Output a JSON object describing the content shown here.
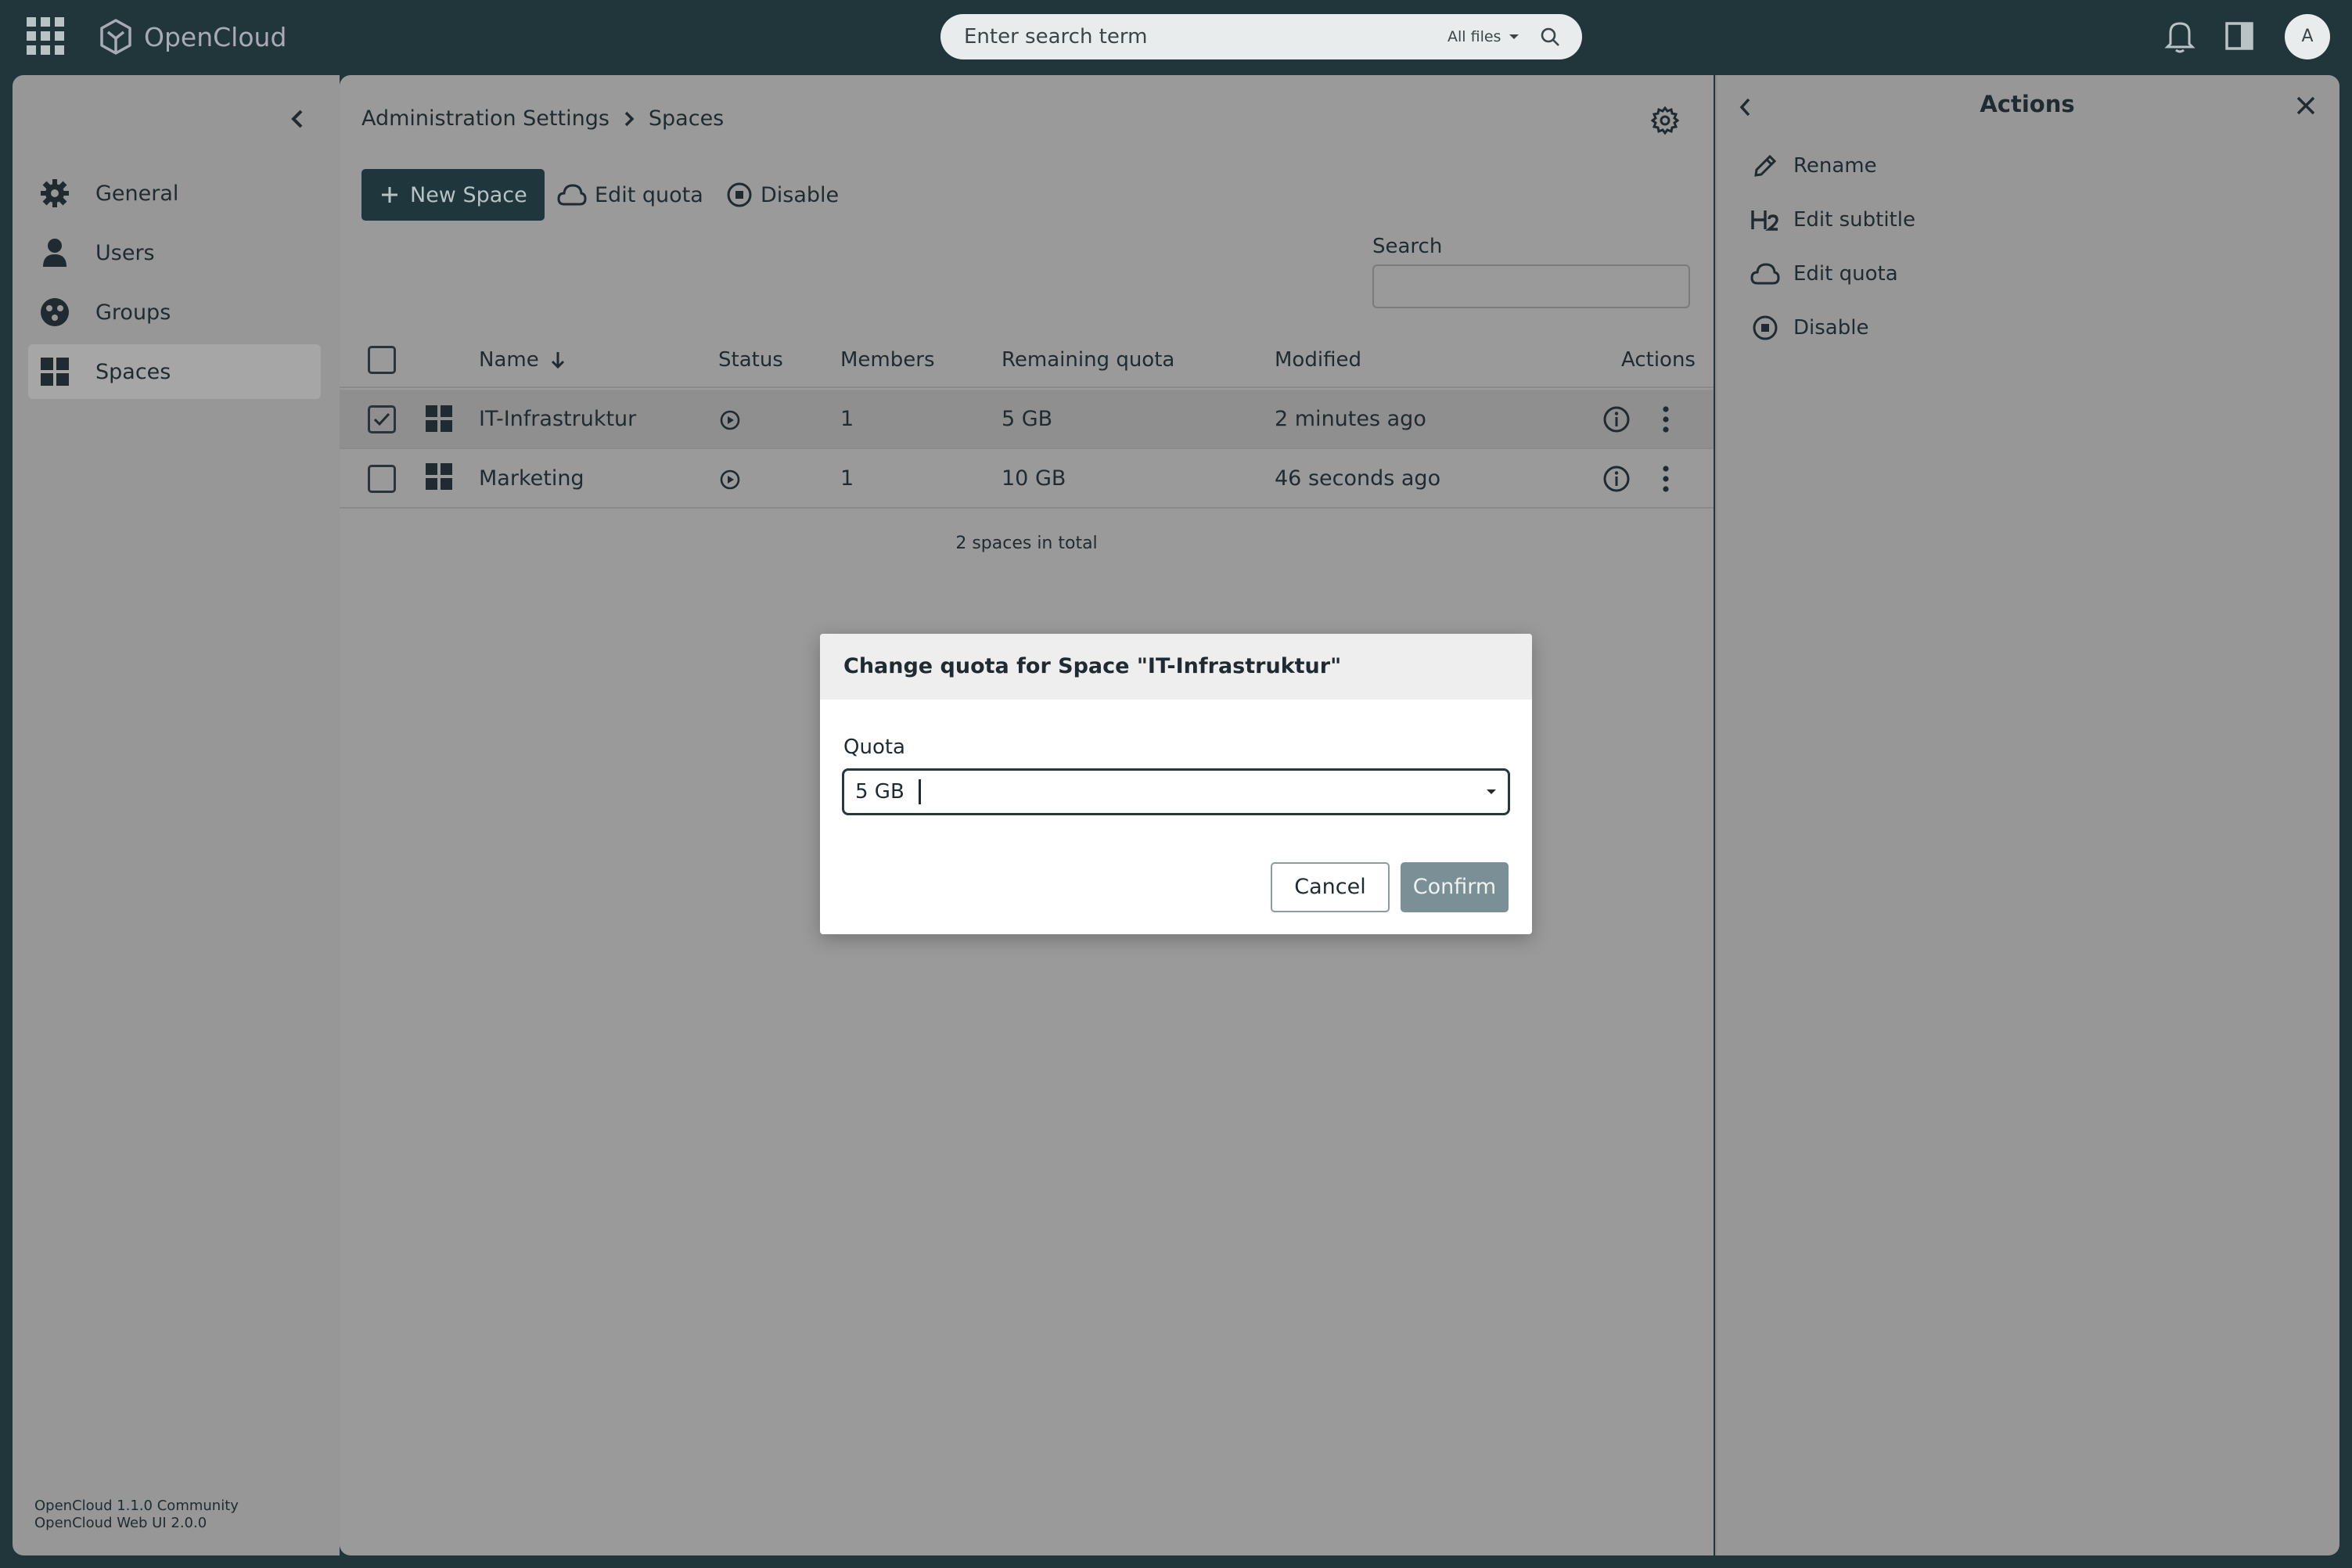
{
  "app": {
    "name": "OpenCloud",
    "avatar_initial": "A"
  },
  "search": {
    "placeholder": "Enter search term",
    "scope": "All files"
  },
  "sidebar": {
    "items": [
      {
        "label": "General",
        "icon": "gear-icon"
      },
      {
        "label": "Users",
        "icon": "user-icon"
      },
      {
        "label": "Groups",
        "icon": "groups-icon"
      },
      {
        "label": "Spaces",
        "icon": "spaces-icon",
        "active": true
      }
    ],
    "version_line1": "OpenCloud 1.1.0 Community",
    "version_line2": "OpenCloud Web UI 2.0.0"
  },
  "breadcrumb": {
    "parent": "Administration Settings",
    "current": "Spaces"
  },
  "toolbar": {
    "new_space": "New Space",
    "edit_quota": "Edit quota",
    "disable": "Disable"
  },
  "filter": {
    "search_label": "Search"
  },
  "table": {
    "headers": {
      "name": "Name",
      "status": "Status",
      "members": "Members",
      "remaining_quota": "Remaining quota",
      "modified": "Modified",
      "actions": "Actions"
    },
    "rows": [
      {
        "name": "IT-Infrastruktur",
        "members": "1",
        "remaining_quota": "5 GB",
        "modified": "2 minutes ago",
        "selected": true
      },
      {
        "name": "Marketing",
        "members": "1",
        "remaining_quota": "10 GB",
        "modified": "46 seconds ago",
        "selected": false
      }
    ],
    "total": "2 spaces in total"
  },
  "right_panel": {
    "title": "Actions",
    "items": [
      {
        "label": "Rename",
        "icon": "pencil-icon"
      },
      {
        "label": "Edit subtitle",
        "icon": "heading-h2-icon"
      },
      {
        "label": "Edit quota",
        "icon": "cloud-icon"
      },
      {
        "label": "Disable",
        "icon": "stop-circle-icon"
      }
    ]
  },
  "modal": {
    "title": "Change quota for Space \"IT-Infrastruktur\"",
    "quota_label": "Quota",
    "quota_value": "5 GB",
    "cancel": "Cancel",
    "confirm": "Confirm"
  },
  "colors": {
    "topbar": "#20363b",
    "primary_button": "#1f373c",
    "confirm_button": "#7a9096",
    "logo": "#a9aab8"
  }
}
